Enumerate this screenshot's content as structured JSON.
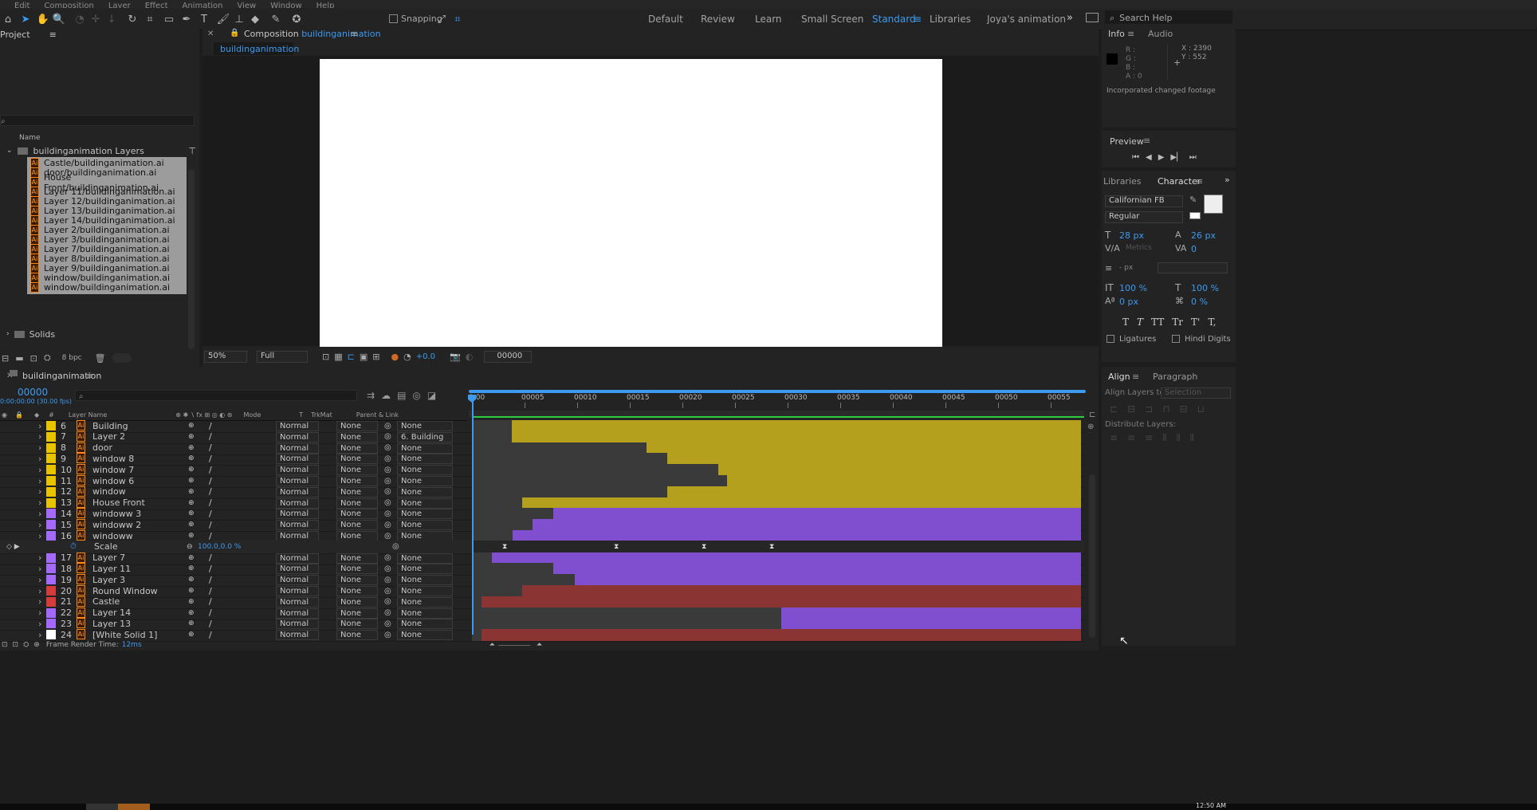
{
  "menu": [
    "Edit",
    "Composition",
    "Layer",
    "Effect",
    "Animation",
    "View",
    "Window",
    "Help"
  ],
  "toolbar": {
    "snapping": "Snapping",
    "workspaces": [
      "Default",
      "Review",
      "Learn",
      "Small Screen",
      "Standard",
      "Libraries",
      "Joya's animation"
    ],
    "active_workspace": "Standard",
    "search_placeholder": "Search Help"
  },
  "project": {
    "title": "Project",
    "col_name": "Name",
    "folder": "buildinganimation Layers",
    "items": [
      "Castle/buildinganimation.ai",
      "door/buildinganimation.ai",
      "House Front/buildinganimation.ai",
      "Layer 11/buildinganimation.ai",
      "Layer 12/buildinganimation.ai",
      "Layer 13/buildinganimation.ai",
      "Layer 14/buildinganimation.ai",
      "Layer 2/buildinganimation.ai",
      "Layer 3/buildinganimation.ai",
      "Layer 7/buildinganimation.ai",
      "Layer 8/buildinganimation.ai",
      "Layer 9/buildinganimation.ai",
      "window/buildinganimation.ai",
      "window/buildinganimation.ai"
    ],
    "solids": "Solids",
    "bpc": "8 bpc"
  },
  "composition": {
    "tab_prefix": "Composition",
    "name": "buildinganimation",
    "subtab": "buildinganimation",
    "zoom": "50%",
    "quality": "Full",
    "exposure": "+0.0",
    "timecode": "00000"
  },
  "info": {
    "tab": "Info",
    "tab2": "Audio",
    "r": "R :",
    "g": "G :",
    "b": "B :",
    "a": "A : 0",
    "x": "X : 2390",
    "y": "Y : 552",
    "message": "Incorporated changed footage"
  },
  "preview": {
    "title": "Preview"
  },
  "character": {
    "tab_lib": "Libraries",
    "tab": "Character",
    "font": "Californian FB",
    "style": "Regular",
    "size": "28 px",
    "leading": "26 px",
    "kerning": "Metrics",
    "tracking": "0",
    "stroke": "- px",
    "vscale": "100 %",
    "hscale": "100 %",
    "baseline": "0 px",
    "tsume": "0 %",
    "ligatures": "Ligatures",
    "hindi": "Hindi Digits",
    "styles": [
      "T",
      "T",
      "TT",
      "Tr",
      "T'",
      "T,"
    ]
  },
  "align": {
    "tab": "Align",
    "tab2": "Paragraph",
    "align_to": "Align Layers to:",
    "selection": "Selection",
    "distribute": "Distribute Layers:"
  },
  "timeline": {
    "tab": "buildinganimation",
    "timecode": "00000",
    "fps": "0:00:00:00 (30.00 fps)",
    "cols": {
      "layer_name": "Layer Name",
      "mode": "Mode",
      "t": "T",
      "trkmat": "TrkMat",
      "parent": "Parent & Link"
    },
    "ruler": [
      "0:00",
      "00005",
      "00010",
      "00015",
      "00020",
      "00025",
      "00030",
      "00035",
      "00040",
      "00045",
      "00050",
      "00055"
    ],
    "render_label": "Frame Render Time:",
    "render_value": "12ms",
    "layers": [
      {
        "num": "6",
        "name": "Building",
        "mode": "Normal",
        "trk": "None",
        "parent": "None",
        "color": "#e8c400",
        "bar": "#b5a01e",
        "start": 0.05
      },
      {
        "num": "7",
        "name": "Layer 2",
        "mode": "Normal",
        "trk": "None",
        "parent": "6. Building",
        "color": "#e8c400",
        "bar": "#b5a01e",
        "start": 0.05
      },
      {
        "num": "8",
        "name": "door",
        "mode": "Normal",
        "trk": "None",
        "parent": "None",
        "color": "#e8c400",
        "bar": "#b5a01e",
        "start": 0.275
      },
      {
        "num": "9",
        "name": "window 8",
        "mode": "Normal",
        "trk": "None",
        "parent": "None",
        "color": "#e8c400",
        "bar": "#b5a01e",
        "start": 0.31
      },
      {
        "num": "10",
        "name": "window 7",
        "mode": "Normal",
        "trk": "None",
        "parent": "None",
        "color": "#e8c400",
        "bar": "#b5a01e",
        "start": 0.395
      },
      {
        "num": "11",
        "name": "window 6",
        "mode": "Normal",
        "trk": "None",
        "parent": "None",
        "color": "#e8c400",
        "bar": "#b5a01e",
        "start": 0.41
      },
      {
        "num": "12",
        "name": "window",
        "mode": "Normal",
        "trk": "None",
        "parent": "None",
        "color": "#e8c400",
        "bar": "#b5a01e",
        "start": 0.31
      },
      {
        "num": "13",
        "name": "House Front",
        "mode": "Normal",
        "trk": "None",
        "parent": "None",
        "color": "#e8c400",
        "bar": "#b5a01e",
        "start": 0.068
      },
      {
        "num": "14",
        "name": "windoww 3",
        "mode": "Normal",
        "trk": "None",
        "parent": "None",
        "color": "#a469ff",
        "bar": "#7f4fcf",
        "start": 0.12
      },
      {
        "num": "15",
        "name": "windoww 2",
        "mode": "Normal",
        "trk": "None",
        "parent": "None",
        "color": "#a469ff",
        "bar": "#7f4fcf",
        "start": 0.085
      },
      {
        "num": "16",
        "name": "windoww",
        "mode": "Normal",
        "trk": "None",
        "parent": "None",
        "color": "#a469ff",
        "bar": "#7f4fcf",
        "start": 0.052
      }
    ],
    "scale": {
      "label": "Scale",
      "value": "100.0,0.0 %"
    },
    "layers2": [
      {
        "num": "17",
        "name": "Layer 7",
        "mode": "Normal",
        "trk": "None",
        "parent": "None",
        "color": "#a469ff",
        "bar": "#7f4fcf",
        "start": 0.017
      },
      {
        "num": "18",
        "name": "Layer 11",
        "mode": "Normal",
        "trk": "None",
        "parent": "None",
        "color": "#a469ff",
        "bar": "#7f4fcf",
        "start": 0.12
      },
      {
        "num": "19",
        "name": "Layer 3",
        "mode": "Normal",
        "trk": "None",
        "parent": "None",
        "color": "#a469ff",
        "bar": "#7f4fcf",
        "start": 0.155
      },
      {
        "num": "20",
        "name": "Round Window",
        "mode": "Normal",
        "trk": "None",
        "parent": "None",
        "color": "#d43c3c",
        "bar": "#8a3434",
        "start": 0.068
      },
      {
        "num": "21",
        "name": "Castle",
        "mode": "Normal",
        "trk": "None",
        "parent": "None",
        "color": "#d43c3c",
        "bar": "#8a3434",
        "start": 0.0
      },
      {
        "num": "22",
        "name": "Layer 14",
        "mode": "Normal",
        "trk": "None",
        "parent": "None",
        "color": "#a469ff",
        "bar": "#7f4fcf",
        "start": 0.5
      },
      {
        "num": "23",
        "name": "Layer 13",
        "mode": "Normal",
        "trk": "None",
        "parent": "None",
        "color": "#a469ff",
        "bar": "#7f4fcf",
        "start": 0.5
      },
      {
        "num": "24",
        "name": "[White Solid 1]",
        "mode": "Normal",
        "trk": "None",
        "parent": "None",
        "color": "#ffffff",
        "bar": "#8a3434",
        "start": 0.0
      }
    ]
  },
  "taskbar": {
    "time": "12:50 AM"
  }
}
